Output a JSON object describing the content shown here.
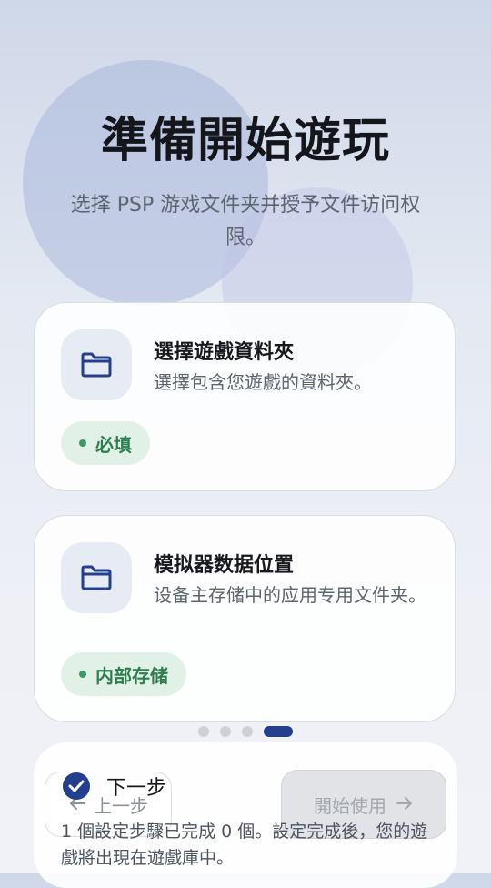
{
  "header": {
    "title": "準備開始遊玩",
    "subtitle": "选择 PSP 游戏文件夹并授予文件访问权限。"
  },
  "cards": [
    {
      "icon": "folder-icon",
      "title": "選擇遊戲資料夾",
      "description": "選擇包含您遊戲的資料夾。",
      "badge": "必填"
    },
    {
      "icon": "folder-icon",
      "title": "模拟器数据位置",
      "description": "设备主存储中的应用专用文件夹。",
      "badge": "内部存储"
    }
  ],
  "pager": {
    "total": 4,
    "active": 4
  },
  "footer": {
    "prev_label": "上一步",
    "next_label": "下一步",
    "start_label": "開始使用",
    "status": "1 個設定步驟已完成 0 個。設定完成後，您的遊戲將出現在遊戲庫中。"
  },
  "colors": {
    "accent": "#23408e",
    "badge_bg": "#e1f1e8",
    "badge_text": "#2e7d4f"
  }
}
